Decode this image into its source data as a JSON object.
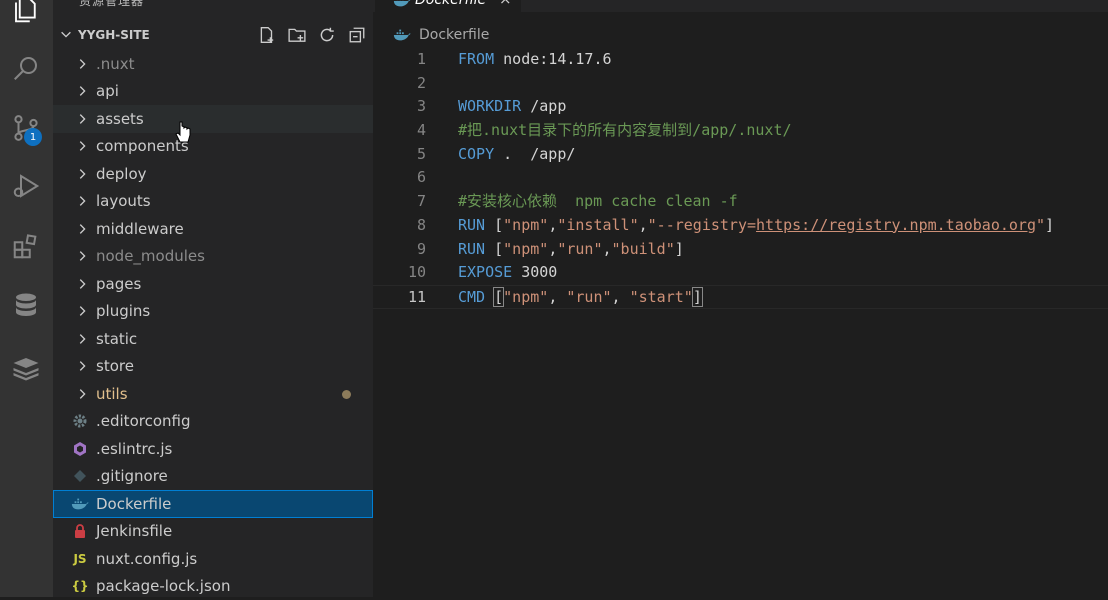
{
  "sidebar": {
    "title": "资源管理器",
    "section": {
      "label": "YYGH-SITE"
    },
    "items": [
      {
        "label": ".nuxt",
        "type": "folder",
        "state": "dim"
      },
      {
        "label": "api",
        "type": "folder",
        "state": ""
      },
      {
        "label": "assets",
        "type": "folder",
        "state": "hover"
      },
      {
        "label": "components",
        "type": "folder",
        "state": ""
      },
      {
        "label": "deploy",
        "type": "folder",
        "state": ""
      },
      {
        "label": "layouts",
        "type": "folder",
        "state": ""
      },
      {
        "label": "middleware",
        "type": "folder",
        "state": ""
      },
      {
        "label": "node_modules",
        "type": "folder",
        "state": "dim"
      },
      {
        "label": "pages",
        "type": "folder",
        "state": ""
      },
      {
        "label": "plugins",
        "type": "folder",
        "state": ""
      },
      {
        "label": "static",
        "type": "folder",
        "state": ""
      },
      {
        "label": "store",
        "type": "folder",
        "state": ""
      },
      {
        "label": "utils",
        "type": "folder",
        "state": "modified"
      },
      {
        "label": ".editorconfig",
        "type": "file",
        "icon": "gear-icon",
        "state": ""
      },
      {
        "label": ".eslintrc.js",
        "type": "file",
        "icon": "eslint-icon",
        "state": ""
      },
      {
        "label": ".gitignore",
        "type": "file",
        "icon": "git-icon",
        "state": ""
      },
      {
        "label": "Dockerfile",
        "type": "file",
        "icon": "docker-icon",
        "state": "selected"
      },
      {
        "label": "Jenkinsfile",
        "type": "file",
        "icon": "jenkins-icon",
        "state": ""
      },
      {
        "label": "nuxt.config.js",
        "type": "file",
        "icon": "js-icon",
        "icon_text": "JS",
        "state": ""
      },
      {
        "label": "package-lock.json",
        "type": "file",
        "icon": "json-icon",
        "icon_text": "{}",
        "state": ""
      }
    ]
  },
  "activity": {
    "scm_badge": "1"
  },
  "editor": {
    "tab": {
      "label": "Dockerfile",
      "close": "×"
    },
    "breadcrumb": "Dockerfile",
    "current_line": 11,
    "lines": [
      {
        "n": "1"
      },
      {
        "n": "2"
      },
      {
        "n": "3"
      },
      {
        "n": "4"
      },
      {
        "n": "5"
      },
      {
        "n": "6"
      },
      {
        "n": "7"
      },
      {
        "n": "8"
      },
      {
        "n": "9"
      },
      {
        "n": "10"
      },
      {
        "n": "11"
      }
    ],
    "code": {
      "l1": [
        "FROM",
        " node:14.17.6"
      ],
      "l3": [
        "WORKDIR",
        " /app"
      ],
      "l4": "#把.nuxt目录下的所有内容复制到/app/.nuxt/",
      "l5": [
        "COPY",
        " .  /app/"
      ],
      "l7": "#安装核心依赖  npm cache clean -f",
      "l8": [
        "RUN",
        " [",
        "\"npm\"",
        ",",
        "\"install\"",
        ",",
        "\"--registry=",
        "https://registry.npm.taobao.org",
        "\"",
        "]"
      ],
      "l9": [
        "RUN",
        " [",
        "\"npm\"",
        ",",
        "\"run\"",
        ",",
        "\"build\"",
        "]"
      ],
      "l10": [
        "EXPOSE",
        " 3000"
      ],
      "l11": [
        "CMD",
        " ",
        "[",
        "\"npm\"",
        ", ",
        "\"run\"",
        ", ",
        "\"start\"",
        "]"
      ]
    }
  },
  "colors": {
    "keyword": "#569cd6",
    "string": "#ce9178",
    "comment": "#6a9955",
    "selection": "#094771",
    "modified": "#e2c08d"
  }
}
